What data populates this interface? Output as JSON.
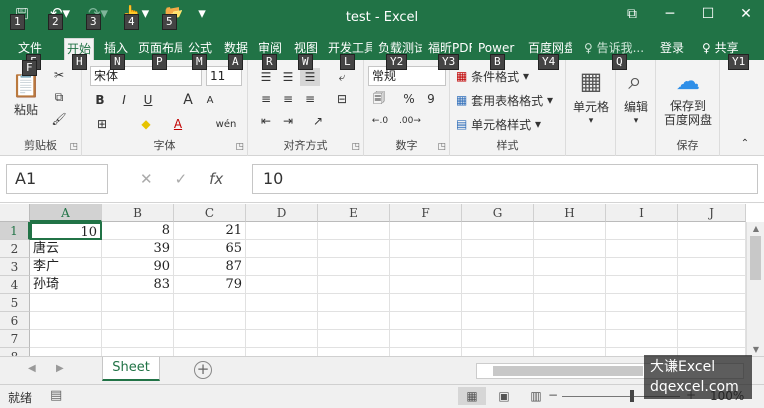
{
  "window": {
    "title": "test - Excel",
    "controls": {
      "restore": "⧉",
      "minimize": "─",
      "maximize": "☐",
      "close": "✕"
    }
  },
  "qat": [
    {
      "icon": "save-icon",
      "glyph": "🖫",
      "keytip": "1"
    },
    {
      "icon": "undo-icon",
      "glyph": "↶▾",
      "keytip": "2"
    },
    {
      "icon": "redo-icon",
      "glyph": "↷▾",
      "keytip": "3"
    },
    {
      "icon": "touch-mode-icon",
      "glyph": "👆▾",
      "keytip": "4"
    },
    {
      "icon": "open-icon",
      "glyph": "📂",
      "keytip": "5"
    },
    {
      "icon": "customize-qat-icon",
      "glyph": "▾",
      "keytip": ""
    }
  ],
  "tabs": [
    {
      "label": "文件",
      "keytip": "F"
    },
    {
      "label": "开始",
      "keytip": "H",
      "active": true
    },
    {
      "label": "插入",
      "keytip": "N"
    },
    {
      "label": "页面布局",
      "keytip": "P"
    },
    {
      "label": "公式",
      "keytip": "M"
    },
    {
      "label": "数据",
      "keytip": "A"
    },
    {
      "label": "审阅",
      "keytip": "R"
    },
    {
      "label": "视图",
      "keytip": "W"
    },
    {
      "label": "开发工具",
      "keytip": "L"
    },
    {
      "label": "负载测试",
      "keytip": "Y2"
    },
    {
      "label": "福昕PDF",
      "keytip": "Y3"
    },
    {
      "label": "Power",
      "keytip": "B"
    },
    {
      "label": "百度网盘",
      "keytip": "Y4"
    }
  ],
  "tellme": {
    "label": "♀ 告诉我...",
    "keytip": "Q"
  },
  "account": {
    "login": "登录",
    "share": "♀ 共享",
    "share_keytip": "Y1"
  },
  "ribbon": {
    "clipboard": {
      "label": "剪贴板",
      "paste": "粘贴",
      "paste_icon": "📋",
      "cut_icon": "✂",
      "copy_icon": "⧉",
      "painter_icon": "🖌"
    },
    "font": {
      "label": "字体",
      "name": "宋体",
      "size": "11",
      "bold": "B",
      "italic": "I",
      "underline": "U",
      "grow": "A",
      "shrink": "A",
      "border_icon": "⊞",
      "fill_icon": "◆",
      "color_icon": "A",
      "wen": "wén"
    },
    "alignment": {
      "label": "对齐方式"
    },
    "number": {
      "label": "数字",
      "format": "常规",
      "currency": "🗐",
      "percent": "%",
      "comma": "9"
    },
    "styles": {
      "label": "样式",
      "conditional": "条件格式",
      "table": "套用表格格式",
      "cell": "单元格样式"
    },
    "cells": {
      "label": "单元格"
    },
    "edit": {
      "label": "编辑"
    },
    "save": {
      "label": "保存",
      "button": "保存到\n百度网盘",
      "line1": "保存到",
      "line2": "百度网盘"
    }
  },
  "keytips_ribbon": [
    "F",
    "H",
    "N",
    "P",
    "M",
    "A",
    "R",
    "W",
    "L",
    "Y2",
    "Y3",
    "B",
    "Y4",
    "Q",
    "Y1"
  ],
  "formula_bar": {
    "name_box": "A1",
    "cancel": "✕",
    "enter": "✓",
    "fx": "fx",
    "value": "10"
  },
  "sheet": {
    "columns": [
      "A",
      "B",
      "C",
      "D",
      "E",
      "F",
      "G",
      "H",
      "I",
      "J"
    ],
    "rows": [
      "1",
      "2",
      "3",
      "4",
      "5",
      "6",
      "7",
      "8"
    ],
    "cells": [
      [
        "10",
        "8",
        "21"
      ],
      [
        "唐云",
        "39",
        "65"
      ],
      [
        "李广",
        "90",
        "87"
      ],
      [
        "孙琦",
        "83",
        "79"
      ]
    ],
    "active_cell": "A1"
  },
  "sheet_tabs": {
    "tabs": [
      "Sheet"
    ],
    "add": "+"
  },
  "status": {
    "ready": "就绪",
    "zoom": "100%",
    "zoom_minus": "−",
    "zoom_plus": "+"
  },
  "watermark": {
    "line1": "大谦Excel",
    "line2": "dqexcel.com"
  }
}
